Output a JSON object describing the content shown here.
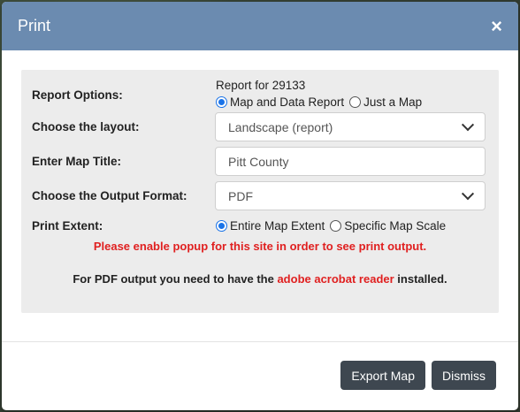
{
  "dialog": {
    "title": "Print",
    "close_glyph": "×"
  },
  "report_options": {
    "label": "Report Options:",
    "report_text": "Report for 29133",
    "options": [
      "Map and Data Report",
      "Just a Map"
    ],
    "selected": "Map and Data Report"
  },
  "layout": {
    "label": "Choose the layout:",
    "value": "Landscape (report)"
  },
  "map_title": {
    "label": "Enter Map Title:",
    "value": "Pitt County"
  },
  "output_format": {
    "label": "Choose the Output Format:",
    "value": "PDF"
  },
  "print_extent": {
    "label": "Print Extent:",
    "options": [
      "Entire Map Extent",
      "Specific Map Scale"
    ],
    "selected": "Entire Map Extent"
  },
  "messages": {
    "popup_warning": "Please enable popup for this site in order to see print output.",
    "pdf_prefix": "For PDF output you need to have the",
    "pdf_link": "adobe acrobat reader",
    "pdf_suffix": "installed."
  },
  "footer": {
    "export_label": "Export Map",
    "dismiss_label": "Dismiss"
  },
  "colors": {
    "header": "#6b8bb0",
    "warning": "#e02020",
    "button": "#3e4750"
  }
}
